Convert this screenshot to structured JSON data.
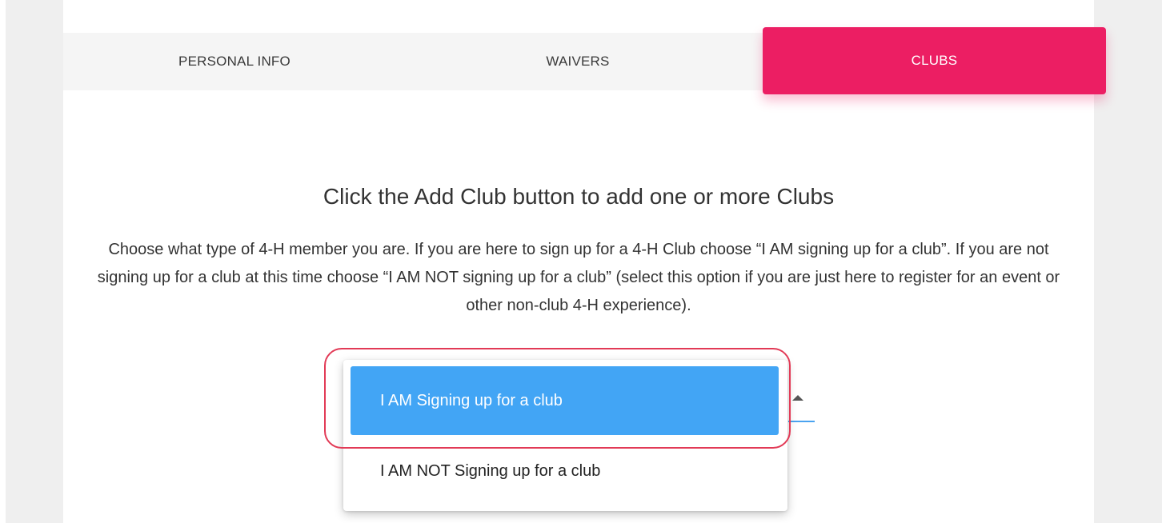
{
  "tabs": {
    "personal_info": "PERSONAL INFO",
    "waivers": "WAIVERS",
    "clubs": "CLUBS"
  },
  "content": {
    "heading": "Click the Add Club button to add one or more Clubs",
    "instructions": "Choose what type of 4-H member you are. If you are here to sign up for a 4-H Club choose “I AM signing up for a club”. If you are not signing up for a club at this time choose “I AM NOT signing up for a club” (select this option if you are just here to register for an event or other non-club 4-H experience)."
  },
  "member_type_select": {
    "icon": "caret-up-icon",
    "options": [
      {
        "label": "I AM Signing up for a club",
        "selected": true
      },
      {
        "label": "I AM NOT Signing up for a club",
        "selected": false
      }
    ]
  },
  "colors": {
    "active_tab": "#ec1e63",
    "selected_option": "#42a5f5",
    "highlight_outline": "#e23a56"
  }
}
